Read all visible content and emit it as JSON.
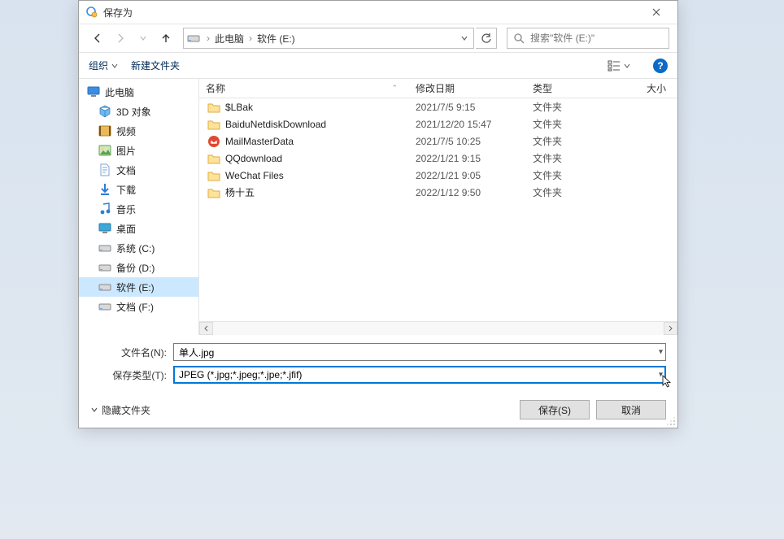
{
  "title": "保存为",
  "nav": {
    "path_segments": [
      "此电脑",
      "软件 (E:)"
    ]
  },
  "search": {
    "placeholder": "搜索\"软件 (E:)\""
  },
  "toolbar": {
    "organize": "组织",
    "new_folder": "新建文件夹"
  },
  "tree": {
    "root": "此电脑",
    "children": [
      {
        "label": "3D 对象",
        "icon": "cube"
      },
      {
        "label": "视频",
        "icon": "video"
      },
      {
        "label": "图片",
        "icon": "picture"
      },
      {
        "label": "文档",
        "icon": "doc"
      },
      {
        "label": "下载",
        "icon": "download"
      },
      {
        "label": "音乐",
        "icon": "music"
      },
      {
        "label": "桌面",
        "icon": "desktop"
      },
      {
        "label": "系统 (C:)",
        "icon": "drive"
      },
      {
        "label": "备份 (D:)",
        "icon": "drive"
      },
      {
        "label": "软件 (E:)",
        "icon": "drive",
        "selected": true
      },
      {
        "label": "文档 (F:)",
        "icon": "drive"
      }
    ]
  },
  "columns": {
    "name": "名称",
    "date": "修改日期",
    "type": "类型",
    "size": "大小"
  },
  "rows": [
    {
      "name": "$LBak",
      "date": "2021/7/5 9:15",
      "type": "文件夹",
      "icon": "folder"
    },
    {
      "name": "BaiduNetdiskDownload",
      "date": "2021/12/20 15:47",
      "type": "文件夹",
      "icon": "folder"
    },
    {
      "name": "MailMasterData",
      "date": "2021/7/5 10:25",
      "type": "文件夹",
      "icon": "mail"
    },
    {
      "name": "QQdownload",
      "date": "2022/1/21 9:15",
      "type": "文件夹",
      "icon": "folder"
    },
    {
      "name": "WeChat Files",
      "date": "2022/1/21 9:05",
      "type": "文件夹",
      "icon": "folder"
    },
    {
      "name": "杨十五",
      "date": "2022/1/12 9:50",
      "type": "文件夹",
      "icon": "folder"
    }
  ],
  "form": {
    "filename_label": "文件名(N):",
    "filename_value": "单人.jpg",
    "filetype_label": "保存类型(T):",
    "filetype_value": "JPEG (*.jpg;*.jpeg;*.jpe;*.jfif)"
  },
  "actions": {
    "hide_folders": "隐藏文件夹",
    "save": "保存(S)",
    "cancel": "取消"
  }
}
